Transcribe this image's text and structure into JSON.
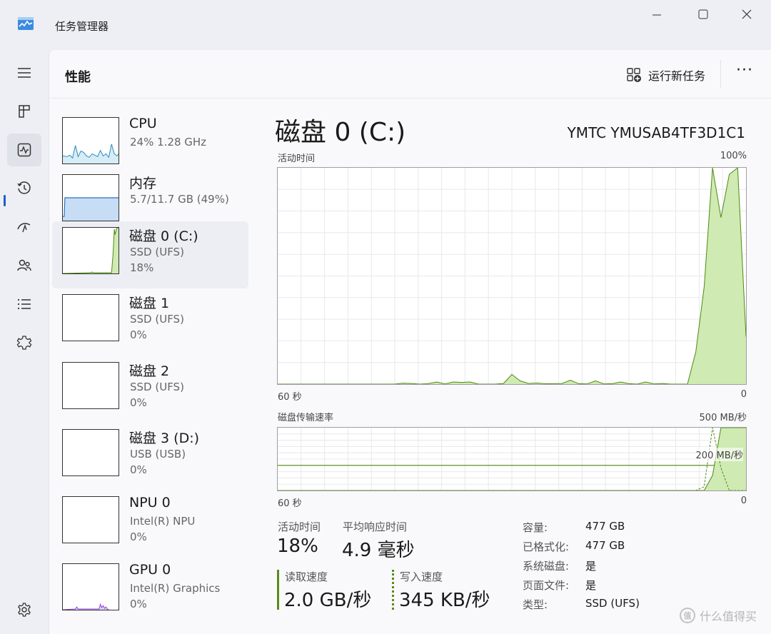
{
  "window": {
    "title": "任务管理器"
  },
  "header": {
    "title": "性能",
    "run_task_label": "运行新任务",
    "more_label": "···"
  },
  "devices": [
    {
      "name": "CPU",
      "sub": "24%  1.28 GHz",
      "sub2": ""
    },
    {
      "name": "内存",
      "sub": "5.7/11.7 GB (49%)",
      "sub2": ""
    },
    {
      "name": "磁盘 0 (C:)",
      "sub": "SSD (UFS)",
      "sub2": "18%"
    },
    {
      "name": "磁盘 1",
      "sub": "SSD (UFS)",
      "sub2": "0%"
    },
    {
      "name": "磁盘 2",
      "sub": "SSD (UFS)",
      "sub2": "0%"
    },
    {
      "name": "磁盘 3 (D:)",
      "sub": "USB (USB)",
      "sub2": "0%"
    },
    {
      "name": "NPU 0",
      "sub": "Intel(R) NPU",
      "sub2": "0%"
    },
    {
      "name": "GPU 0",
      "sub": "Intel(R) Graphics",
      "sub2": "0%"
    }
  ],
  "main": {
    "title": "磁盘 0 (C:)",
    "model": "YMTC YMUSAB4TF3D1C1",
    "activity_graph": {
      "label": "活动时间",
      "max_label": "100%",
      "x_left_label": "60 秒",
      "x_right_label": "0",
      "values": [
        0,
        0,
        0,
        0,
        0,
        0,
        0,
        0,
        0,
        0,
        0,
        0,
        0,
        0,
        0,
        0.4,
        0.3,
        0,
        0.2,
        1.0,
        0.1,
        1.0,
        0.8,
        1.0,
        0,
        0,
        0,
        0.3,
        4.5,
        1.5,
        0.3,
        0.5,
        0.2,
        0.2,
        0.3,
        1.8,
        0.2,
        0.1,
        1.5,
        0.1,
        0.2,
        1.0,
        0.2,
        0,
        1.0,
        0.1,
        0.3,
        0,
        0,
        0,
        15,
        45,
        100,
        77,
        97,
        100,
        22
      ]
    },
    "transfer_graph": {
      "label": "磁盘传输速率",
      "max_label": "500 MB/秒",
      "mid_label": "200 MB/秒",
      "x_left_label": "60 秒",
      "x_right_label": "0",
      "read_values": [
        0,
        0,
        0,
        0,
        0,
        0,
        0,
        0,
        0,
        0,
        0,
        0,
        0,
        0,
        0,
        0,
        0,
        0,
        0,
        0,
        0,
        0,
        0,
        0,
        0,
        0,
        0,
        0,
        0,
        0,
        0,
        0,
        0,
        0,
        0,
        0,
        0,
        0,
        0,
        0,
        0,
        0,
        0,
        0,
        0,
        0,
        0,
        0,
        0,
        0,
        0,
        0,
        120,
        520,
        520,
        520,
        520
      ],
      "write_values": [
        0,
        0,
        0,
        0,
        0,
        0,
        0,
        0,
        0,
        0,
        0,
        0,
        0,
        0,
        0,
        0,
        0,
        0,
        0,
        0,
        0,
        0,
        0,
        0,
        0,
        0,
        0,
        0,
        0,
        0,
        0,
        0,
        0,
        0,
        0,
        0,
        0,
        0,
        0,
        0,
        0,
        0,
        0,
        0,
        0,
        0,
        0,
        0,
        0,
        0,
        0,
        30,
        500,
        180,
        0,
        0,
        0
      ],
      "y_max": 500
    },
    "stats": {
      "active_time_label": "活动时间",
      "active_time_value": "18%",
      "avg_response_label": "平均响应时间",
      "avg_response_value": "4.9 毫秒",
      "read_speed_label": "读取速度",
      "read_speed_value": "2.0 GB/秒",
      "write_speed_label": "写入速度",
      "write_speed_value": "345 KB/秒"
    },
    "info": [
      {
        "key": "容量:",
        "value": "477 GB"
      },
      {
        "key": "已格式化:",
        "value": "477 GB"
      },
      {
        "key": "系统磁盘:",
        "value": "是"
      },
      {
        "key": "页面文件:",
        "value": "是"
      },
      {
        "key": "类型:",
        "value": "SSD (UFS)"
      }
    ]
  },
  "colors": {
    "disk_line": "#4e8a12",
    "disk_fill": "#cfeab2",
    "cpu_line": "#2a8ab8",
    "memory_line": "#2a6fc0",
    "memory_fill": "#c7ddf5",
    "gpu_line": "#8b3fd6",
    "accent": "#1d60c8"
  },
  "watermark": {
    "text": "什么值得买",
    "logo": "值"
  }
}
